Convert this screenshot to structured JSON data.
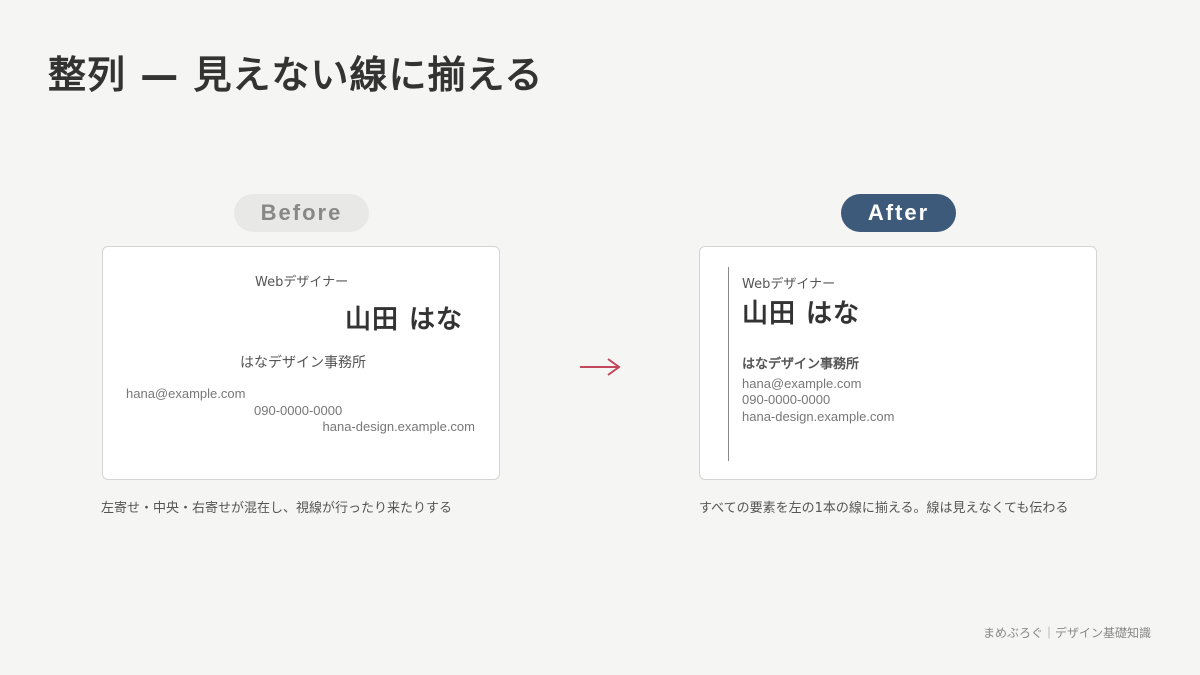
{
  "title": "整列 — 見えない線に揃える",
  "before": {
    "badge": "Before",
    "card": {
      "job": "Webデザイナー",
      "name": "山田 はな",
      "office": "はなデザイン事務所",
      "email": "hana@example.com",
      "phone": "090-0000-0000",
      "website": "hana-design.example.com"
    },
    "caption": "左寄せ・中央・右寄せが混在し、視線が行ったり来たりする"
  },
  "after": {
    "badge": "After",
    "card": {
      "job": "Webデザイナー",
      "name": "山田 はな",
      "office": "はなデザイン事務所",
      "email": "hana@example.com",
      "phone": "090-0000-0000",
      "website": "hana-design.example.com"
    },
    "caption": "すべての要素を左の1本の線に揃える。線は見えなくても伝わる"
  },
  "arrow": {
    "icon": "right-arrow-icon",
    "color": "#c0485a"
  },
  "colors": {
    "after_badge": "#3e5a7a",
    "background": "#f5f5f3"
  },
  "footer": "まめぶろぐ｜デザイン基礎知識"
}
